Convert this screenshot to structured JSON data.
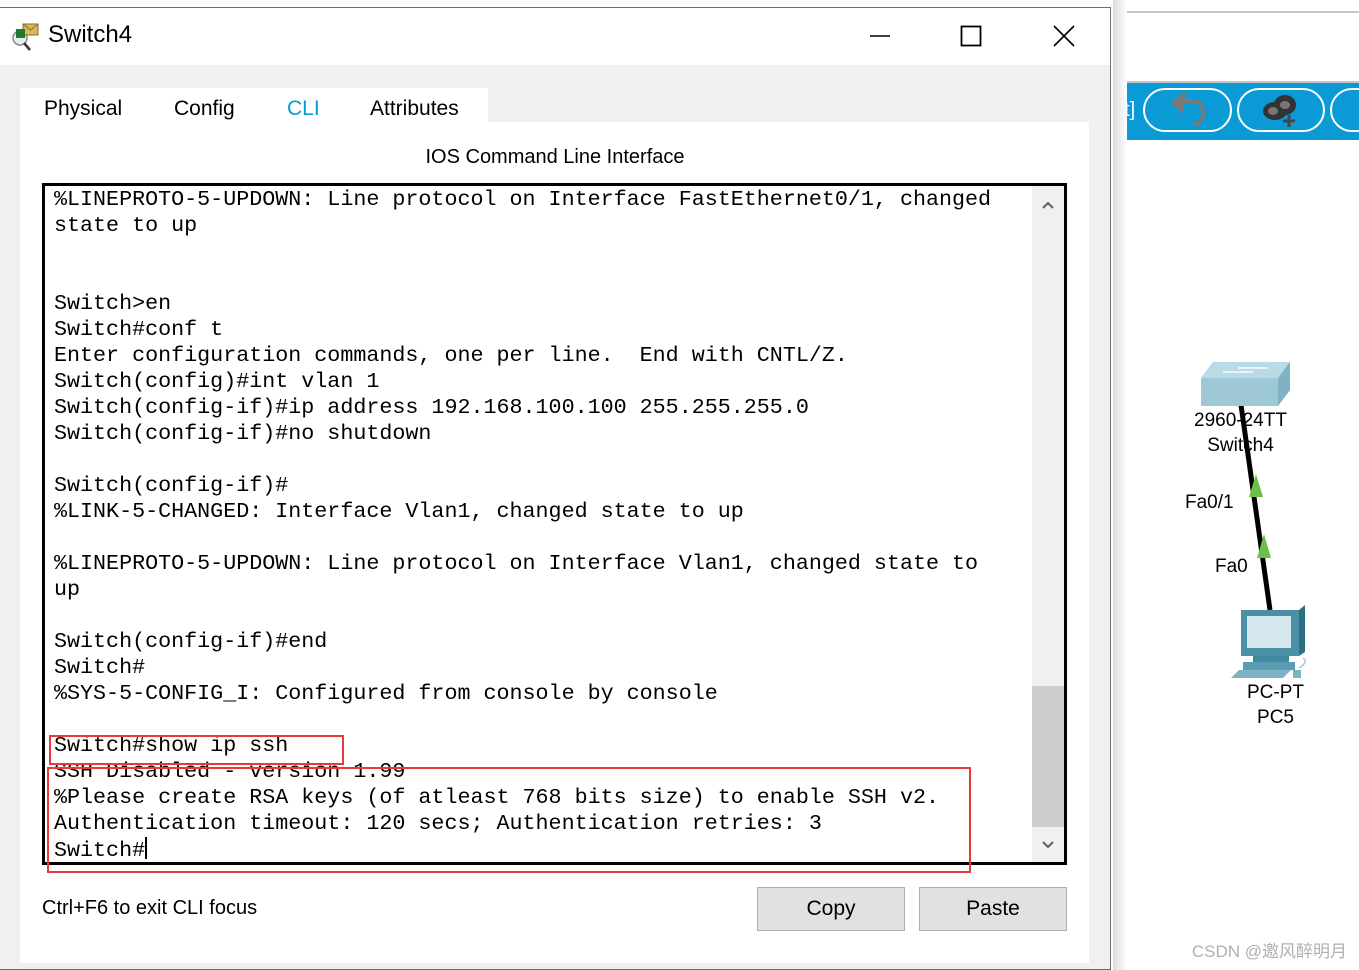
{
  "window": {
    "title": "Switch4",
    "controls": {
      "minimize": "minimize",
      "maximize": "maximize",
      "close": "close"
    }
  },
  "tabs": [
    {
      "label": "Physical",
      "active": false
    },
    {
      "label": "Config",
      "active": false
    },
    {
      "label": "CLI",
      "active": true
    },
    {
      "label": "Attributes",
      "active": false
    }
  ],
  "panel_title": "IOS Command Line Interface",
  "terminal": {
    "lines": [
      "%LINEPROTO-5-UPDOWN: Line protocol on Interface FastEthernet0/1, changed",
      "state to up",
      "",
      "",
      "Switch>en",
      "Switch#conf t",
      "Enter configuration commands, one per line.  End with CNTL/Z.",
      "Switch(config)#int vlan 1",
      "Switch(config-if)#ip address 192.168.100.100 255.255.255.0",
      "Switch(config-if)#no shutdown",
      "",
      "Switch(config-if)#",
      "%LINK-5-CHANGED: Interface Vlan1, changed state to up",
      "",
      "%LINEPROTO-5-UPDOWN: Line protocol on Interface Vlan1, changed state to",
      "up",
      "",
      "Switch(config-if)#end",
      "Switch#",
      "%SYS-5-CONFIG_I: Configured from console by console",
      "",
      "Switch#show ip ssh",
      "SSH Disabled - version 1.99",
      "%Please create RSA keys (of atleast 768 bits size) to enable SSH v2.",
      "Authentication timeout: 120 secs; Authentication retries: 3",
      "Switch#"
    ],
    "scroll_position": "bottom",
    "highlight_color": "#e83a3a"
  },
  "footer": {
    "hint": "Ctrl+F6 to exit CLI focus",
    "copy_label": "Copy",
    "paste_label": "Paste"
  },
  "background_app": {
    "toolbar_text": "ot]",
    "toolbar_color": "#0a9ad6",
    "toolbar_icons": [
      "undo-icon",
      "cloud-add-icon",
      "partial-icon"
    ],
    "topology": {
      "switch_model": "2960-24TT",
      "switch_name": "Switch4",
      "switch_port": "Fa0/1",
      "pc_port": "Fa0",
      "pc_model": "PC-PT",
      "pc_name": "PC5",
      "link_status_color": "#6cc04a"
    },
    "watermark": "CSDN @邀风醉明月"
  },
  "accent_color": "#0a9ad6"
}
